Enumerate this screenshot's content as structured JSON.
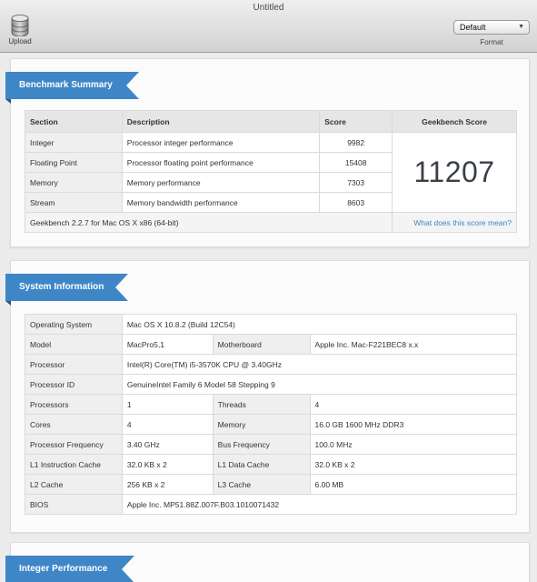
{
  "window": {
    "title": "Untitled"
  },
  "toolbar": {
    "upload_label": "Upload",
    "format_value": "Default",
    "format_label": "Format"
  },
  "benchmark": {
    "heading": "Benchmark Summary",
    "columns": {
      "section": "Section",
      "description": "Description",
      "score": "Score",
      "geekbench": "Geekbench Score"
    },
    "rows": [
      {
        "section": "Integer",
        "description": "Processor integer performance",
        "score": "9982"
      },
      {
        "section": "Floating Point",
        "description": "Processor floating point performance",
        "score": "15408"
      },
      {
        "section": "Memory",
        "description": "Memory performance",
        "score": "7303"
      },
      {
        "section": "Stream",
        "description": "Memory bandwidth performance",
        "score": "8603"
      }
    ],
    "geekbench_score": "11207",
    "version_text": "Geekbench 2.2.7 for Mac OS X x86 (64-bit)",
    "help_link": "What does this score mean?"
  },
  "system": {
    "heading": "System Information",
    "os_label": "Operating System",
    "os_value": "Mac OS X 10.8.2 (Build 12C54)",
    "model_label": "Model",
    "model_value": "MacPro5,1",
    "motherboard_label": "Motherboard",
    "motherboard_value": "Apple Inc. Mac-F221BEC8 x.x",
    "processor_label": "Processor",
    "processor_value": "Intel(R) Core(TM) i5-3570K CPU @ 3.40GHz",
    "processor_id_label": "Processor ID",
    "processor_id_value": "GenuineIntel Family 6 Model 58 Stepping 9",
    "processors_label": "Processors",
    "processors_value": "1",
    "threads_label": "Threads",
    "threads_value": "4",
    "cores_label": "Cores",
    "cores_value": "4",
    "memory_label": "Memory",
    "memory_value": "16.0 GB 1600 MHz DDR3",
    "freq_label": "Processor Frequency",
    "freq_value": "3.40 GHz",
    "bus_label": "Bus Frequency",
    "bus_value": "100.0 MHz",
    "l1i_label": "L1 Instruction Cache",
    "l1i_value": "32.0 KB x 2",
    "l1d_label": "L1 Data Cache",
    "l1d_value": "32.0 KB x 2",
    "l2_label": "L2 Cache",
    "l2_value": "256 KB x 2",
    "l3_label": "L3 Cache",
    "l3_value": "6.00 MB",
    "bios_label": "BIOS",
    "bios_value": "Apple Inc. MP51.88Z.007F.B03.1010071432"
  },
  "integer_section": {
    "heading": "Integer Performance"
  }
}
